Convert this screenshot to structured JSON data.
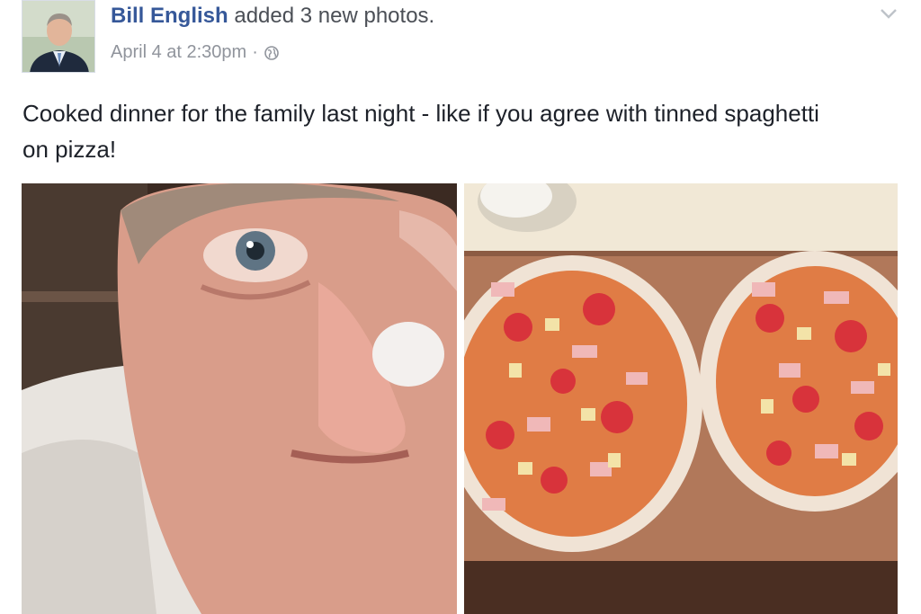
{
  "post": {
    "author_name": "Bill English",
    "action_text": "added 3 new photos.",
    "timestamp": "April 4 at 2:30pm",
    "separator": "·",
    "privacy_icon": "globe-icon",
    "menu_icon": "chevron-down-icon",
    "body_text": "Cooked dinner for the family last night - like if you agree with tinned spaghetti on pizza!"
  },
  "photos": [
    {
      "name": "selfie-photo",
      "description_icon": "photo"
    },
    {
      "name": "pizza-photo",
      "description_icon": "photo"
    }
  ],
  "colors": {
    "author_link": "#365899",
    "meta_gray": "#90949c",
    "body_text": "#1d2129"
  }
}
